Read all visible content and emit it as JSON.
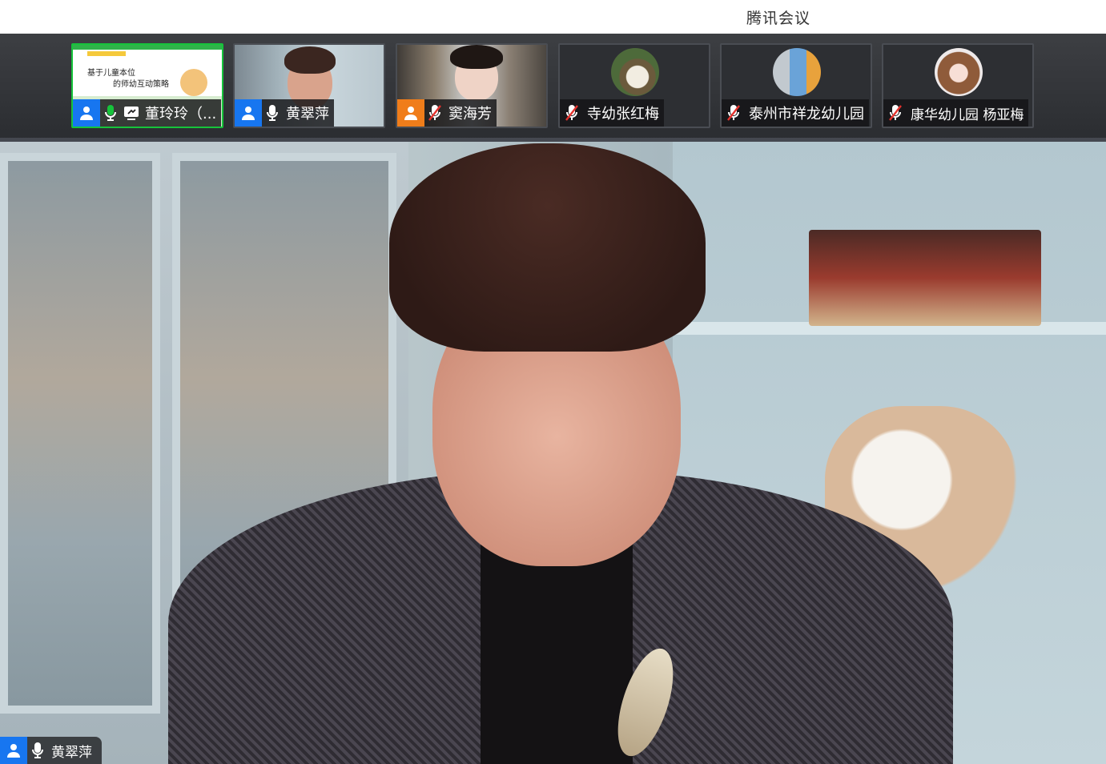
{
  "app": {
    "title": "腾讯会议"
  },
  "participants": [
    {
      "name": "董玲玲（...",
      "role_color": "#1776f0",
      "mic": "on",
      "sharing": true,
      "active": true,
      "slide": {
        "line1": "基于儿童本位",
        "line2": "的师幼互动策略"
      }
    },
    {
      "name": "黄翠萍",
      "role_color": "#1776f0",
      "mic": "on",
      "sharing": false,
      "active": false
    },
    {
      "name": "窦海芳",
      "role_color": "#f07d1a",
      "mic": "muted",
      "sharing": false,
      "active": false
    },
    {
      "name": "寺幼张红梅",
      "role_color": "",
      "mic": "muted",
      "sharing": false,
      "active": false
    },
    {
      "name": "泰州市祥龙幼儿园",
      "role_color": "",
      "mic": "muted",
      "sharing": false,
      "active": false
    },
    {
      "name": "康华幼儿园 杨亚梅",
      "role_color": "",
      "mic": "muted",
      "sharing": false,
      "active": false
    }
  ],
  "main_video": {
    "speaker_name": "黄翠萍",
    "mic": "on"
  },
  "colors": {
    "active_border": "#16c43b",
    "host_blue": "#1776f0",
    "cohost_orange": "#f07d1a",
    "mic_active_green": "#16c43b",
    "mic_muted": "#ffffff"
  }
}
